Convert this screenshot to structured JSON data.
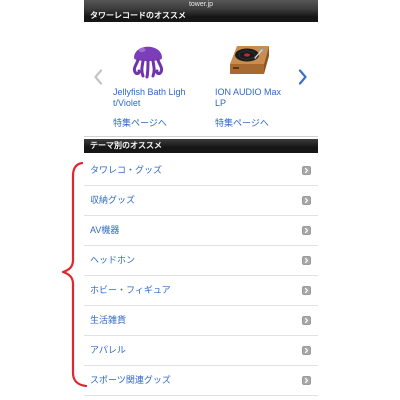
{
  "browser": {
    "url": "tower.jp"
  },
  "featured": {
    "heading": "タワーレコードのオススメ",
    "items": [
      {
        "name": "Jellyfish Bath Light/Violet",
        "link": "特集ページへ",
        "image": "jellyfish-lamp-image"
      },
      {
        "name": "ION AUDIO Max LP",
        "link": "特集ページへ",
        "image": "turntable-image"
      }
    ]
  },
  "themes": {
    "heading": "テーマ別のオススメ",
    "items": [
      {
        "label": "タワレコ・グッズ"
      },
      {
        "label": "収納グッズ"
      },
      {
        "label": "AV機器"
      },
      {
        "label": "ヘッドホン"
      },
      {
        "label": "ホビー・フィギュア"
      },
      {
        "label": "生活雑貨"
      },
      {
        "label": "アパレル"
      },
      {
        "label": "スポーツ関連グッズ"
      }
    ]
  },
  "icons": {
    "carousel_prev": "chevron-left-icon",
    "carousel_next": "chevron-right-icon",
    "row": "link-arrow-icon",
    "annotation": "curly-brace-annotation"
  },
  "colors": {
    "link": "#2f69c5",
    "header_bg": "#161616",
    "header_text": "#ffffff",
    "address_bar_bg": "#3c3c3c",
    "chevron_disabled": "#c4c4c4",
    "chevron_active": "#3a72c9",
    "annotation": "#e0262e"
  }
}
